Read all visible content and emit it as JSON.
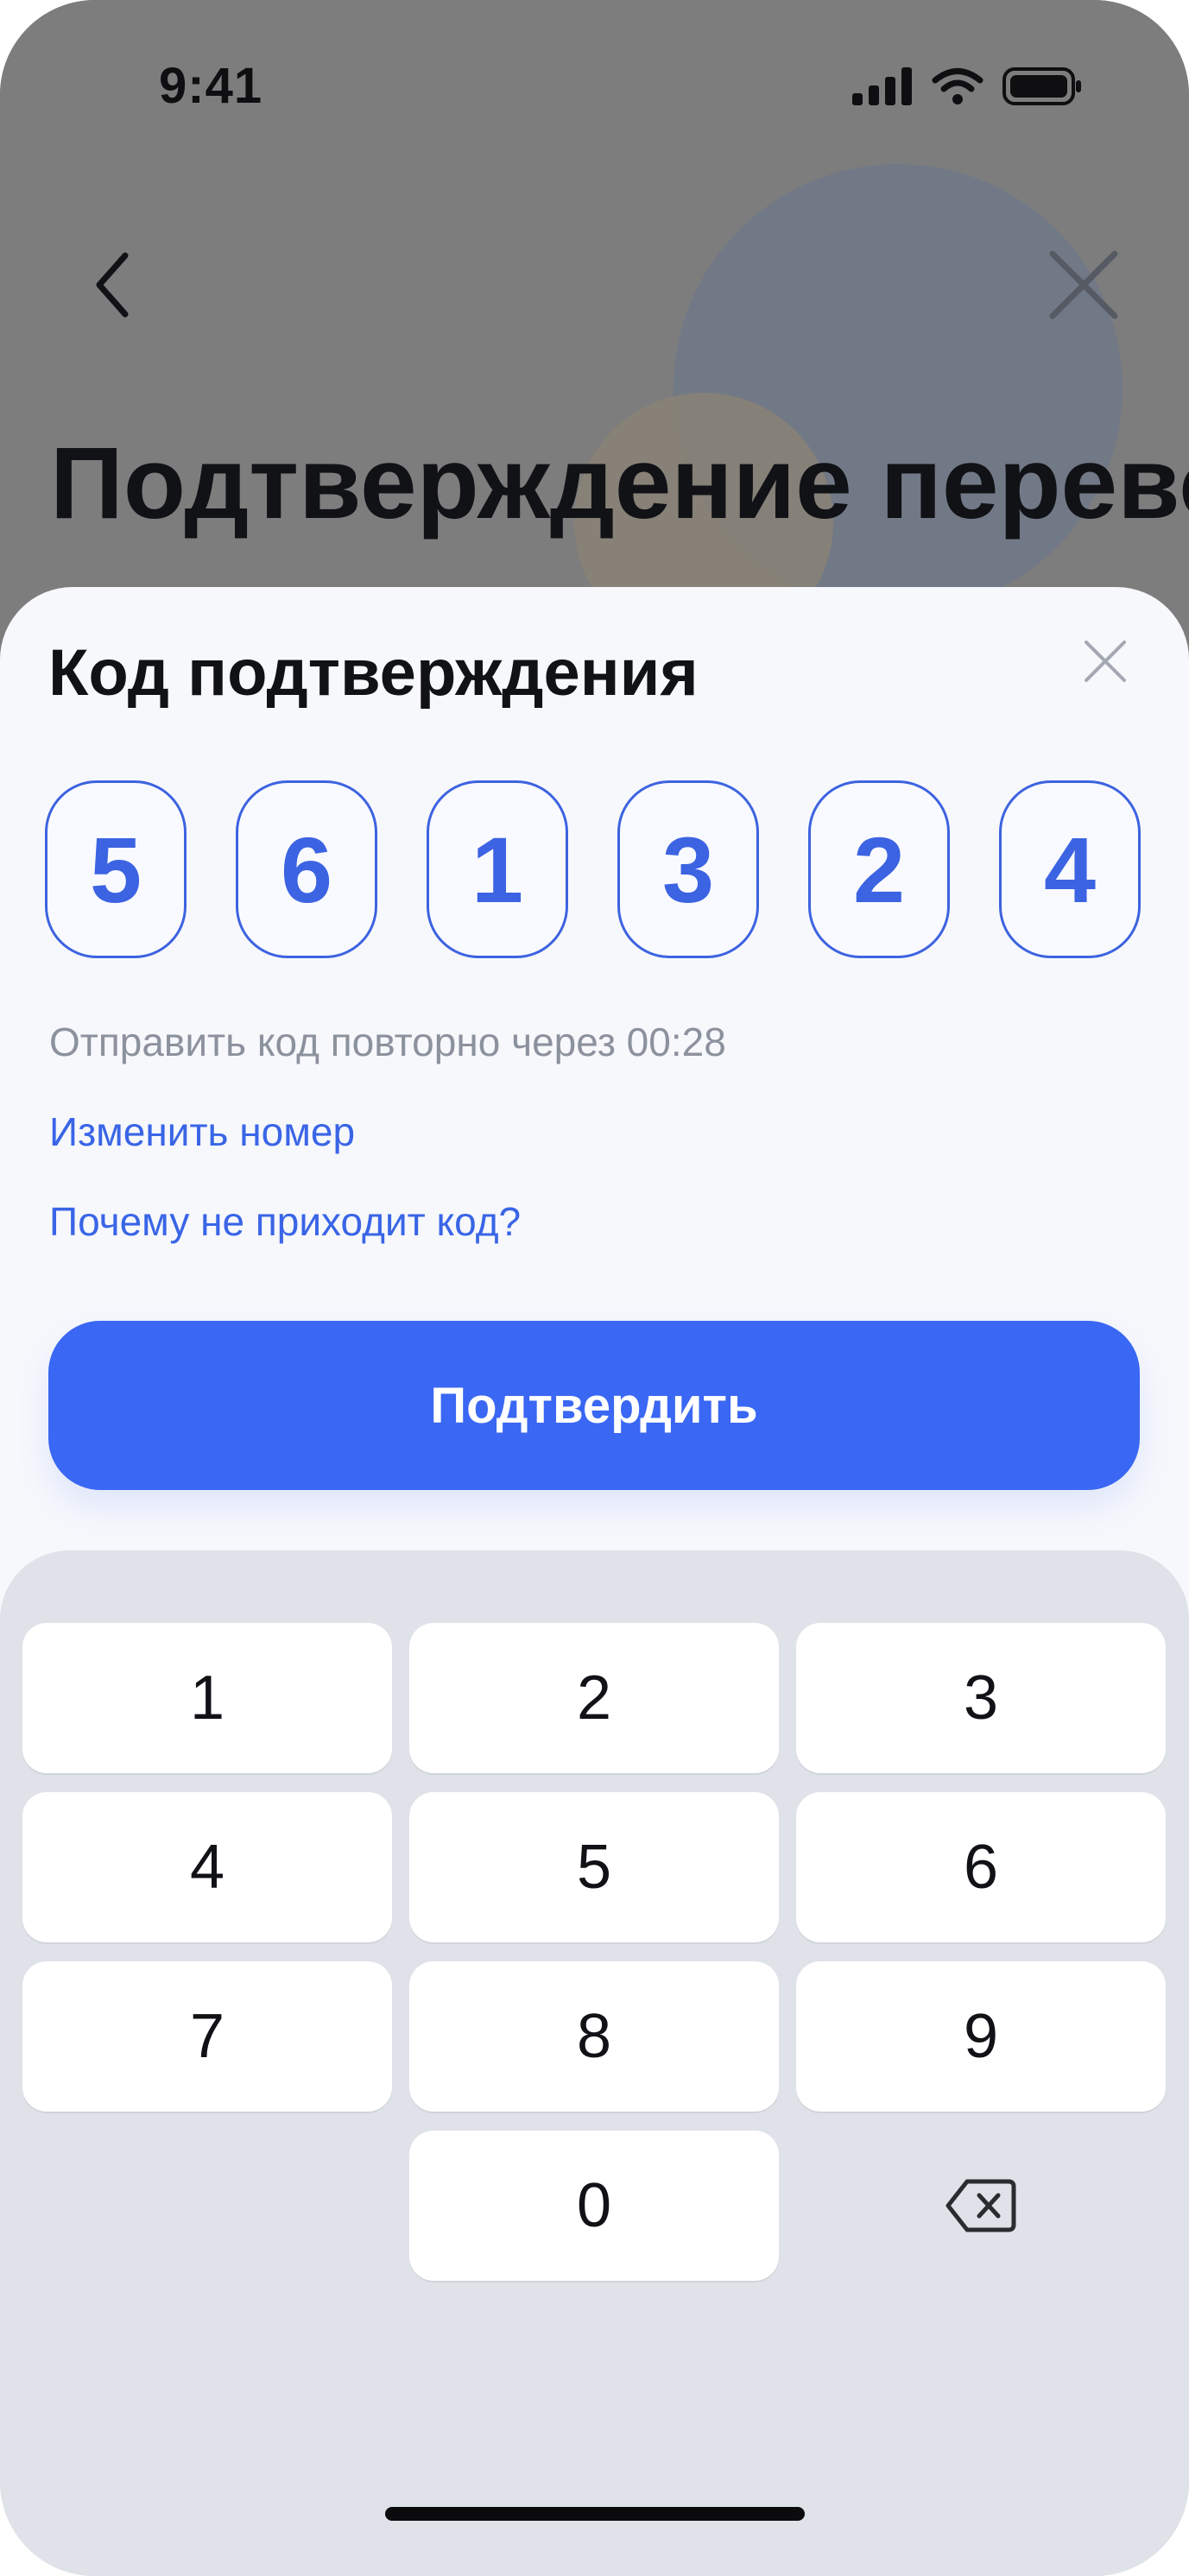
{
  "status_bar": {
    "time": "9:41"
  },
  "background_screen": {
    "title": "Подтверждение перевода"
  },
  "sheet": {
    "title": "Код подтверждения",
    "code_digits": [
      "5",
      "6",
      "1",
      "3",
      "2",
      "4"
    ],
    "resend_text": "Отправить код повторно через 00:28",
    "change_number_link": "Изменить номер",
    "why_no_code_link": "Почему не приходит код?",
    "confirm_button": "Подтвердить"
  },
  "keypad": {
    "keys": [
      "1",
      "2",
      "3",
      "4",
      "5",
      "6",
      "7",
      "8",
      "9",
      "0"
    ],
    "delete_icon": "backspace-icon"
  },
  "colors": {
    "accent": "#3A67F3",
    "code_text": "#3C63E2",
    "link": "#3965E6",
    "muted_text": "#8C929D",
    "keypad_bg": "#DFE2E8"
  }
}
